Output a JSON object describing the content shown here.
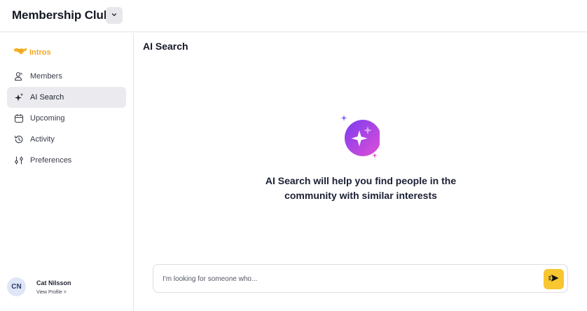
{
  "header": {
    "title": "Membership Club",
    "dropdown_icon": "chevron-down-icon"
  },
  "sidebar": {
    "brand": {
      "label": "Intros",
      "icon": "handshake-icon",
      "color": "#f2a81d"
    },
    "items": [
      {
        "label": "Members",
        "icon": "members-icon",
        "active": false
      },
      {
        "label": "AI Search",
        "icon": "sparkle-icon",
        "active": true
      },
      {
        "label": "Upcoming",
        "icon": "calendar-icon",
        "active": false
      },
      {
        "label": "Activity",
        "icon": "history-icon",
        "active": false
      },
      {
        "label": "Preferences",
        "icon": "sliders-icon",
        "active": false
      }
    ],
    "profile": {
      "initials": "CN",
      "name": "Cat Nilsson",
      "link": "View Profile >"
    }
  },
  "main": {
    "title": "AI Search",
    "hero_icon": "ai-sparkle-icon",
    "hero_line1": "AI Search will help you find people in the",
    "hero_line2": "community with similar interests",
    "search": {
      "placeholder": "I'm looking for someone who...",
      "value": ""
    },
    "send_icon": "send-icon",
    "accent_color": "#f7c631"
  }
}
